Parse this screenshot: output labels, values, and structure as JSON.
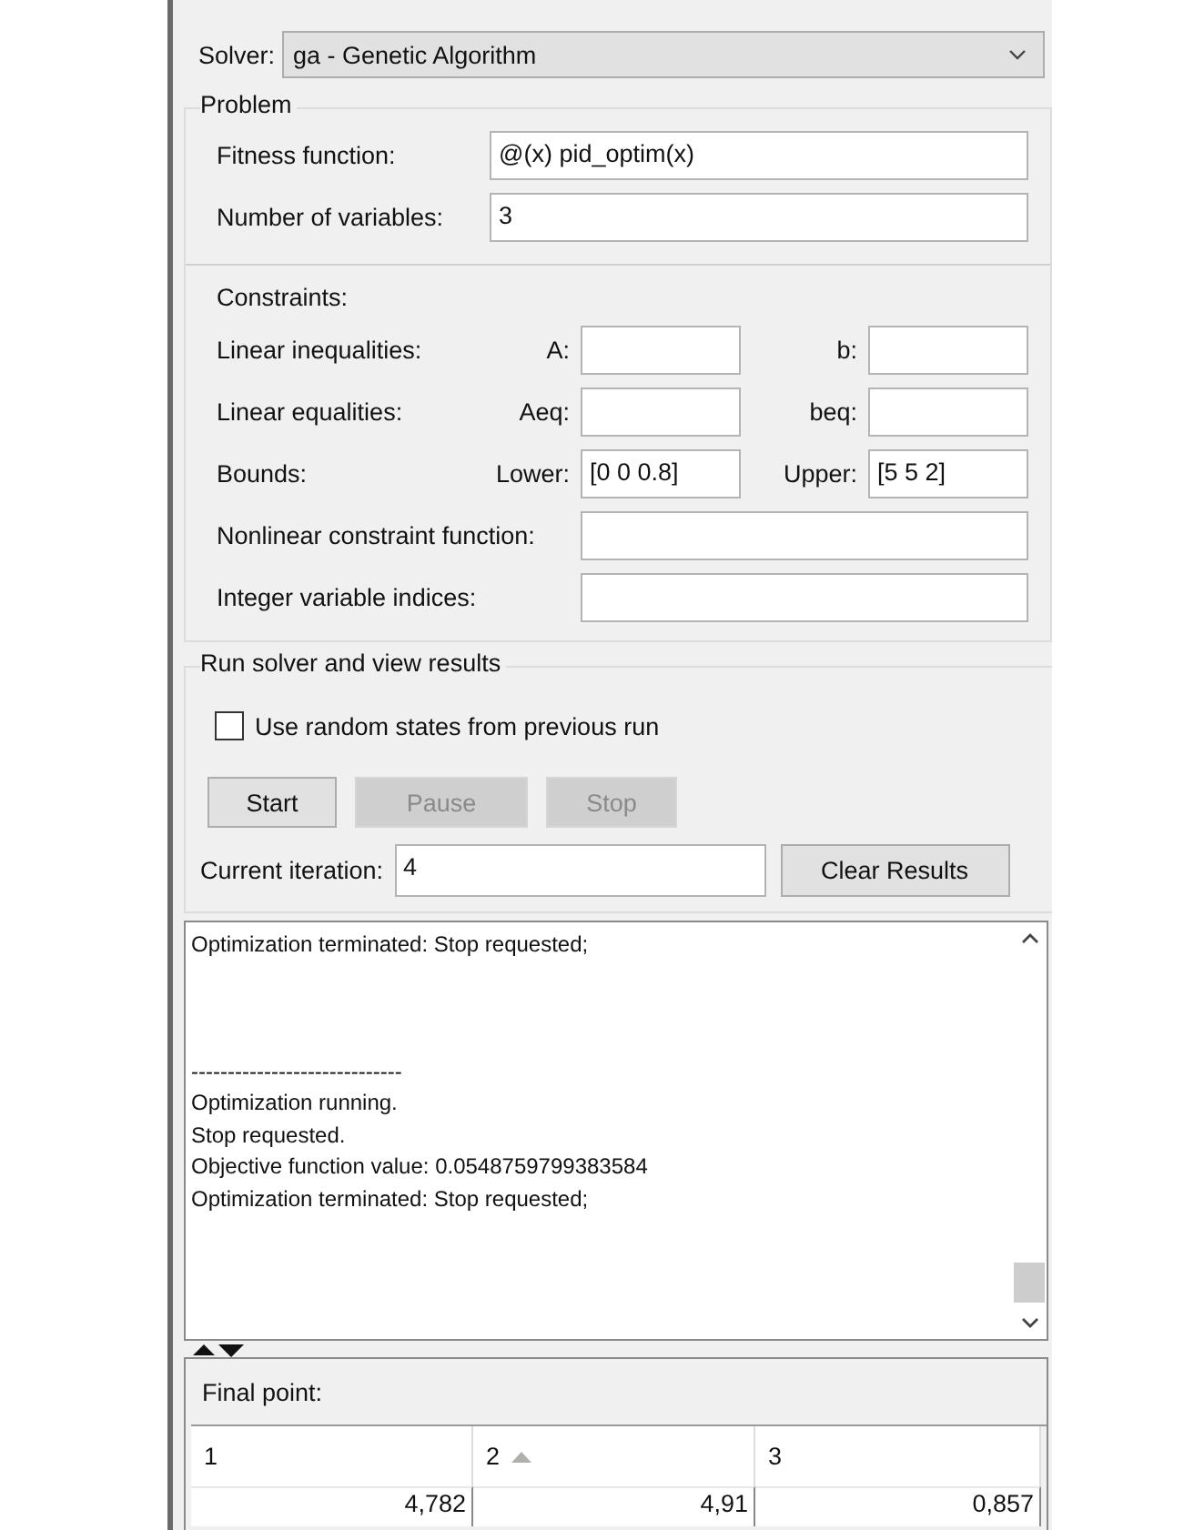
{
  "solver": {
    "label": "Solver:",
    "value": "ga - Genetic Algorithm"
  },
  "problem": {
    "title": "Problem",
    "fields": [
      {
        "label": "Fitness function:",
        "value": "@(x) pid_optim(x)"
      },
      {
        "label": "Number of variables:",
        "value": "3"
      }
    ],
    "constraints_title": "Constraints:",
    "constraints": [
      {
        "kind": "pair",
        "label": "Linear inequalities:",
        "left_label": "A:",
        "right_label": "b:"
      },
      {
        "kind": "pair",
        "label": "Linear equalities:",
        "left_label": "Aeq:",
        "right_label": "beq:"
      },
      {
        "kind": "pair",
        "label": "Bounds:",
        "left_label": "Lower:",
        "left_value": "[0 0 0.8]",
        "right_label": "Upper:",
        "right_value": "[5 5 2]"
      },
      {
        "kind": "single",
        "label": "Nonlinear constraint function:"
      },
      {
        "kind": "single",
        "label": "Integer variable indices:"
      }
    ]
  },
  "run": {
    "title": "Run solver and view results",
    "checkbox": {
      "label": "Use random states from previous run",
      "checked": false
    },
    "buttons": [
      {
        "label": "Start",
        "disabled": false
      },
      {
        "label": "Pause",
        "disabled": true
      },
      {
        "label": "Stop",
        "disabled": true
      }
    ],
    "iteration": {
      "label": "Current iteration:",
      "value": "4"
    },
    "clear_button": "Clear Results",
    "log_blocks": [
      [
        "Optimization terminated: Stop requested;"
      ],
      [
        "-----------------------------",
        "Optimization running.",
        "Stop requested.",
        "Objective function value: 0.0548759799383584",
        "Optimization terminated: Stop requested;"
      ]
    ]
  },
  "final_point": {
    "title": "Final point:",
    "columns": [
      {
        "label": "1",
        "sorted": false
      },
      {
        "label": "2",
        "sorted": true
      },
      {
        "label": "3",
        "sorted": false
      }
    ],
    "values": [
      "4,782",
      "4,91",
      "0,857"
    ]
  }
}
